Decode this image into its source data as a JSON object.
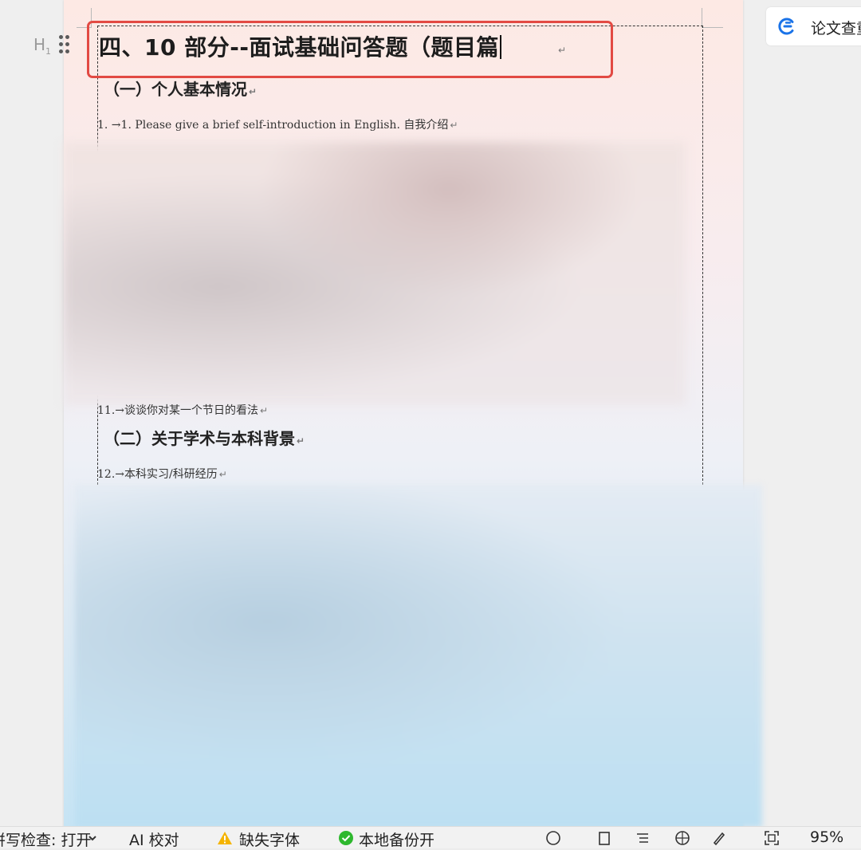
{
  "sidebar": {
    "paper_check_label": "论文查重"
  },
  "document": {
    "heading_marker": "H",
    "heading_marker_sub": "1",
    "heading1": "四、10 部分--面试基础问答题（题目篇",
    "paragraph_mark": "↵",
    "section1_heading": "（一）个人基本情况",
    "line1": "1.  →1. Please give a brief self-introduction in English.  自我介绍",
    "line11": "11.→谈谈你对某一个节日的看法",
    "section2_heading": "（二）关于学术与本科背景",
    "line12": "12.→本科实习/科研经历"
  },
  "statusbar": {
    "spellcheck": "拼写检查: 打开",
    "ai_proofread": "AI 校对",
    "missing_font": "缺失字体",
    "local_backup": "本地备份开",
    "zoom": "95%"
  },
  "colors": {
    "highlight": "#e24a43",
    "accent_blue": "#1a73e8",
    "status_green": "#2eb82e",
    "warning_yellow": "#f5b400"
  }
}
